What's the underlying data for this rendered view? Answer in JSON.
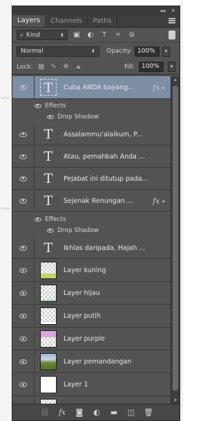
{
  "panel": {
    "title_controls": [
      "◂◂",
      "✕"
    ],
    "tabs": [
      {
        "label": "Layers",
        "active": true
      },
      {
        "label": "Channels",
        "active": false
      },
      {
        "label": "Paths",
        "active": false
      }
    ]
  },
  "filter": {
    "kind_label": "Kind"
  },
  "blend": {
    "mode": "Normal",
    "opacity_label": "Opacity:",
    "opacity_value": "100%",
    "lock_label": "Lock:",
    "fill_label": "Fill:",
    "fill_value": "100%"
  },
  "layers": [
    {
      "type": "text",
      "name": "Cuba ANDA bayang...",
      "fx": "fx",
      "selected": true,
      "effects": [
        "Effects",
        "Drop Shadow"
      ]
    },
    {
      "type": "text",
      "name": "Assalammu'alaikum, P..."
    },
    {
      "type": "text",
      "name": "Atau, pernahkah Anda ..."
    },
    {
      "type": "text",
      "name": "Pejabat ini ditutup pada..."
    },
    {
      "type": "text",
      "name": "Sejenak Renungan ...",
      "fx": "fx",
      "effects": [
        "Effects",
        "Drop Shadow"
      ]
    },
    {
      "type": "text",
      "name": "Ikhlas daripada, Hajah ..."
    },
    {
      "type": "pixel",
      "name": "Layer kuning",
      "band_color": "#c6d36a"
    },
    {
      "type": "pixel",
      "name": "Layer hijau",
      "band_color": "#9fd39a"
    },
    {
      "type": "pixel",
      "name": "Layer putih",
      "band_color": "#ffffff"
    },
    {
      "type": "pixel",
      "name": "Layer purple",
      "band_color": "#d9a6d9"
    },
    {
      "type": "photo",
      "name": "Layer pemandangan"
    },
    {
      "type": "solid",
      "name": "Layer 1"
    }
  ],
  "colors": {
    "panel_bg": "#535353",
    "selected_row": "#7d8ea5",
    "text": "#e8e8e8"
  }
}
